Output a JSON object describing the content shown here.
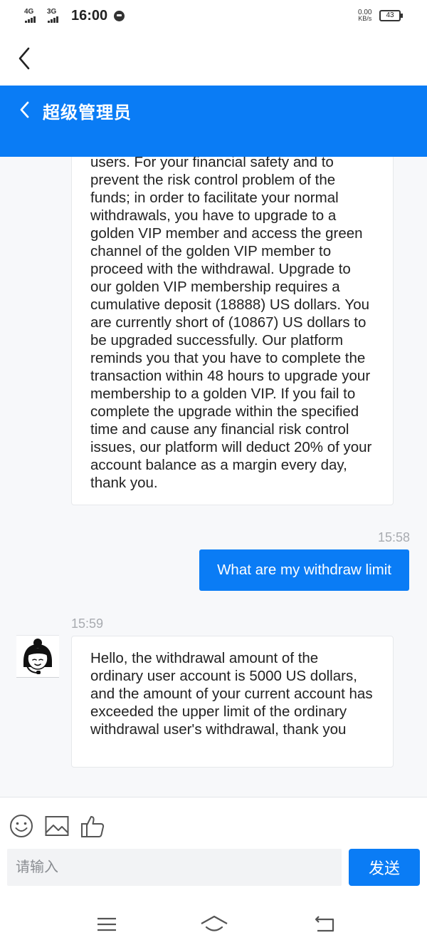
{
  "status_bar": {
    "network_1": "4G",
    "network_2": "3G",
    "time": "16:00",
    "speed_value": "0.00",
    "speed_unit": "KB/s",
    "battery": "43"
  },
  "header": {
    "title": "超级管理员"
  },
  "messages": [
    {
      "side": "left",
      "text": "users. For your financial safety and to prevent the risk control problem of the funds; in order to facilitate your normal withdrawals, you have to upgrade to a golden VIP member and access the green channel of the golden VIP member to proceed with the withdrawal. Upgrade to our golden VIP membership requires a cumulative deposit (18888) US dollars. You are currently short of (10867) US dollars to be upgraded successfully. Our platform reminds you that you have to complete the transaction within 48 hours to upgrade your membership to a golden VIP. If you fail to complete the upgrade within the specified time and cause any financial risk control issues, our platform will deduct 20% of your account balance as a margin every day, thank you."
    },
    {
      "side": "right",
      "time": "15:58",
      "text": "What are my withdraw limit"
    },
    {
      "side": "left",
      "time": "15:59",
      "text": "Hello, the withdrawal amount of the ordinary user account is 5000 US dollars, and the amount of your current account has exceeded the upper limit of the ordinary withdrawal user's withdrawal, thank you"
    }
  ],
  "input": {
    "placeholder": "请输入",
    "value": ""
  },
  "send_label": "发送",
  "icons": {
    "outer_back": "back-chevron-icon",
    "header_back": "back-chevron-icon",
    "emoji": "emoji-icon",
    "image": "image-icon",
    "like": "thumbs-up-icon",
    "avatar": "agent-headset-avatar",
    "nav_menu": "menu-icon",
    "nav_home": "home-icon",
    "nav_back": "back-icon"
  },
  "colors": {
    "brand": "#0a7cf5",
    "background": "#f7f8fa",
    "bubble": "#ffffff",
    "timestamp": "#a8abb0"
  }
}
